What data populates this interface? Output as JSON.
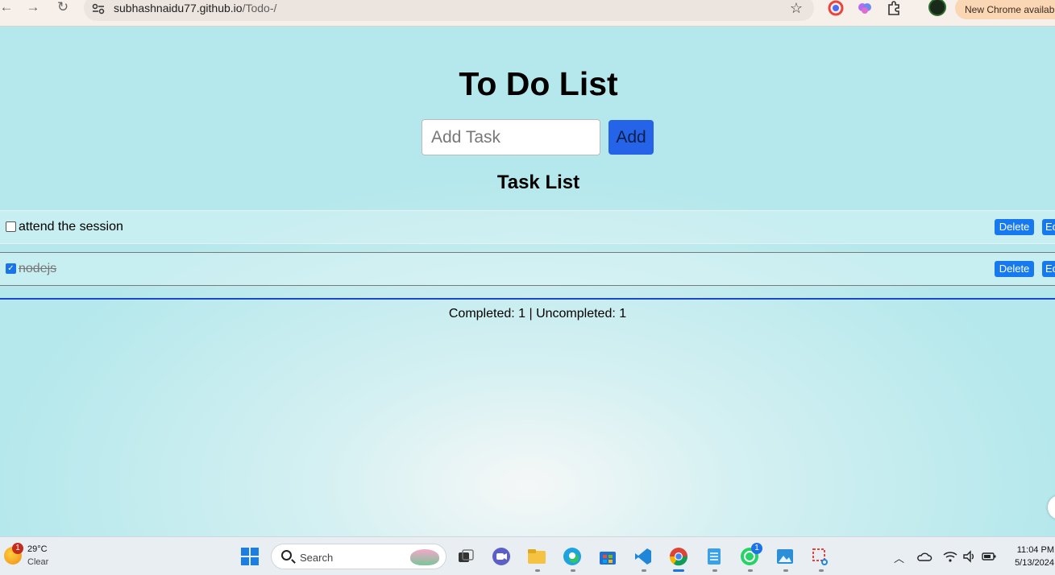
{
  "browser": {
    "url_host": "subhashnaidu77.github.io",
    "url_path": "/Todo-/",
    "update_label": "New Chrome available"
  },
  "app": {
    "title": "To Do List",
    "input_placeholder": "Add Task",
    "add_label": "Add",
    "list_heading": "Task List",
    "tasks": [
      {
        "text": "attend the session",
        "completed": false,
        "delete_label": "Delete",
        "edit_label": "Edit"
      },
      {
        "text": "nodejs",
        "completed": true,
        "delete_label": "Delete",
        "edit_label": "Edit"
      }
    ],
    "stats": "Completed: 1 | Uncompleted: 1"
  },
  "taskbar": {
    "weather_temp": "29°C",
    "weather_condition": "Clear",
    "weather_badge": "1",
    "search_label": "Search",
    "whatsapp_badge": "1",
    "time": "11:04 PM",
    "date": "5/13/2024"
  },
  "colors": {
    "accent": "#2563e8",
    "button": "#1679f0",
    "divider": "#1a49c9"
  }
}
